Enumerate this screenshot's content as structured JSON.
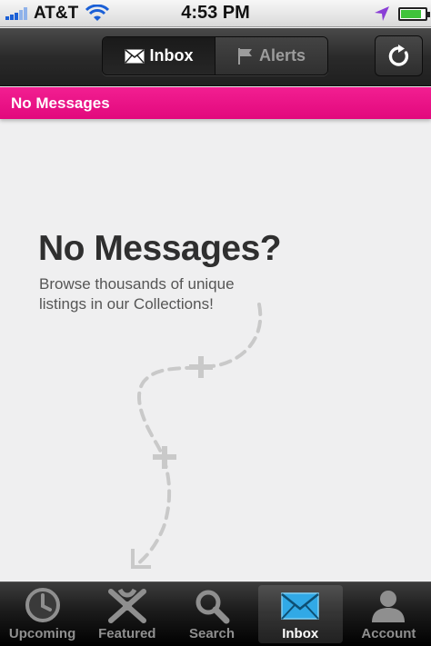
{
  "status_bar": {
    "carrier": "AT&T",
    "time": "4:53 PM",
    "icons": [
      "signal-icon",
      "wifi-icon",
      "location-arrow-icon",
      "battery-icon"
    ]
  },
  "nav": {
    "segments": [
      {
        "label": "Inbox",
        "icon": "envelope-icon",
        "selected": true
      },
      {
        "label": "Alerts",
        "icon": "flag-icon",
        "selected": false
      }
    ],
    "refresh_icon": "refresh-icon"
  },
  "banner": {
    "text": "No Messages"
  },
  "empty_state": {
    "title": "No Messages?",
    "subtitle": "Browse thousands of unique listings in our Collections!"
  },
  "tabs": [
    {
      "label": "Upcoming",
      "icon": "clock-icon"
    },
    {
      "label": "Featured",
      "icon": "featured-icon"
    },
    {
      "label": "Search",
      "icon": "search-icon"
    },
    {
      "label": "Inbox",
      "icon": "envelope-icon",
      "active": true
    },
    {
      "label": "Account",
      "icon": "person-icon"
    }
  ],
  "colors": {
    "accent_pink": "#e8108a",
    "nav_dark": "#2a2a2a",
    "wifi_blue": "#1a5fd6",
    "battery_green": "#3fc33a",
    "envelope_blue": "#31a9e6"
  }
}
